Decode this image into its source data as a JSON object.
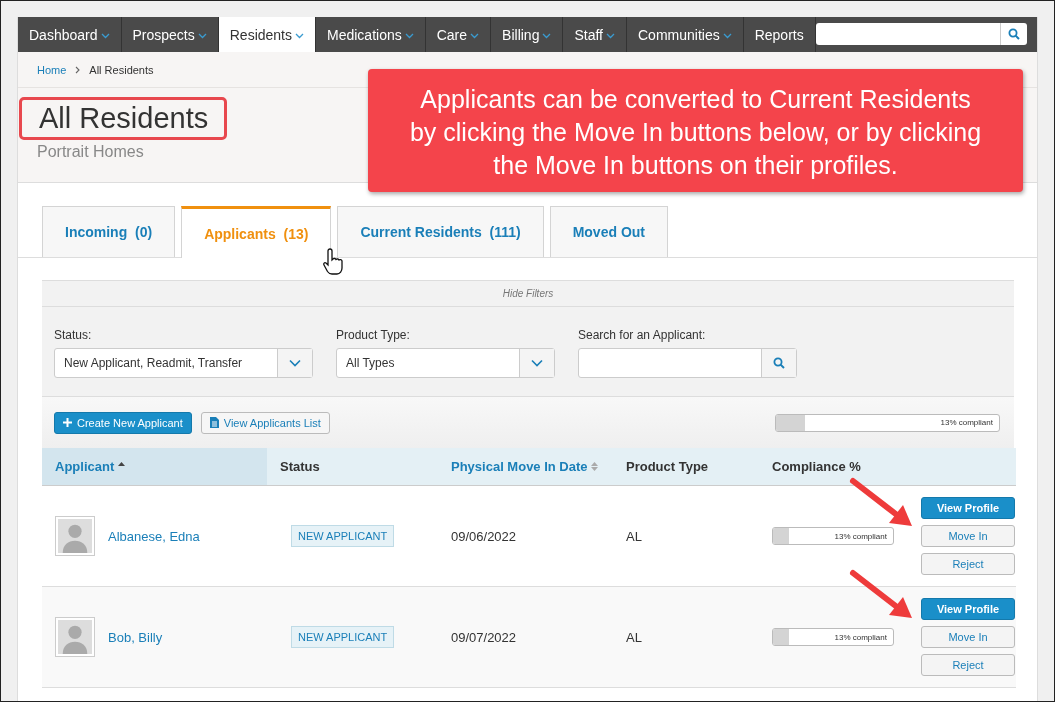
{
  "nav": {
    "items": [
      {
        "label": "Dashboard",
        "dropdown": true,
        "selected": false
      },
      {
        "label": "Prospects",
        "dropdown": true,
        "selected": false
      },
      {
        "label": "Residents",
        "dropdown": true,
        "selected": true
      },
      {
        "label": "Medications",
        "dropdown": true,
        "selected": false
      },
      {
        "label": "Care",
        "dropdown": true,
        "selected": false
      },
      {
        "label": "Billing",
        "dropdown": true,
        "selected": false
      },
      {
        "label": "Staff",
        "dropdown": true,
        "selected": false
      },
      {
        "label": "Communities",
        "dropdown": true,
        "selected": false
      },
      {
        "label": "Reports",
        "dropdown": false,
        "selected": false
      }
    ]
  },
  "breadcrumb": [
    {
      "label": "Home",
      "kind": "link"
    },
    {
      "label": "All Residents",
      "kind": "current"
    }
  ],
  "page": {
    "title": "All Residents",
    "subtitle": "Portrait Homes"
  },
  "callout": {
    "text": "Applicants can be converted to Current Residents by clicking the Move In buttons below, or by clicking the Move In buttons on their profiles."
  },
  "tabs": [
    {
      "label": "Incoming  (0)",
      "selected": false
    },
    {
      "label": "Applicants  (13)",
      "selected": true
    },
    {
      "label": "Current Residents  (111)",
      "selected": false
    },
    {
      "label": "Moved Out",
      "selected": false
    }
  ],
  "filters": {
    "toggle": "Hide Filters",
    "fields": [
      {
        "kind": "select",
        "label": "Status:",
        "value": "New Applicant, Readmit, Transfer"
      },
      {
        "kind": "select",
        "label": "Product Type:",
        "value": "All Types"
      },
      {
        "kind": "search",
        "label": "Search for an Applicant:"
      }
    ]
  },
  "toolbar": {
    "buttons": [
      {
        "label": "Create New Applicant",
        "kind": "primary"
      },
      {
        "label": "View Applicants List",
        "kind": "secondary"
      }
    ],
    "compliance": {
      "level": 0.13,
      "reading": "13% compliant"
    }
  },
  "table": {
    "columns": [
      {
        "label": "Applicant",
        "sortable": true,
        "sorted": true
      },
      {
        "label": "Status",
        "sortable": false,
        "sorted": false
      },
      {
        "label": "Physical Move In Date",
        "sortable": true,
        "sorted": false
      },
      {
        "label": "Product Type",
        "sortable": false,
        "sorted": false
      },
      {
        "label": "Compliance %",
        "sortable": false,
        "sorted": false
      }
    ],
    "rows": [
      {
        "name": "Albanese, Edna",
        "status": "NEW APPLICANT",
        "move_in_date": "09/06/2022",
        "product_type": "AL",
        "compliance": {
          "level": 0.13,
          "reading": "13% compliant"
        },
        "actions": [
          {
            "label": "View Profile",
            "kind": "primary"
          },
          {
            "label": "Move In",
            "kind": "secondary"
          },
          {
            "label": "Reject",
            "kind": "secondary"
          }
        ]
      },
      {
        "name": "Bob, Billy",
        "status": "NEW APPLICANT",
        "move_in_date": "09/07/2022",
        "product_type": "AL",
        "compliance": {
          "level": 0.13,
          "reading": "13% compliant"
        },
        "actions": [
          {
            "label": "View Profile",
            "kind": "primary"
          },
          {
            "label": "Move In",
            "kind": "secondary"
          },
          {
            "label": "Reject",
            "kind": "secondary"
          }
        ]
      }
    ]
  }
}
